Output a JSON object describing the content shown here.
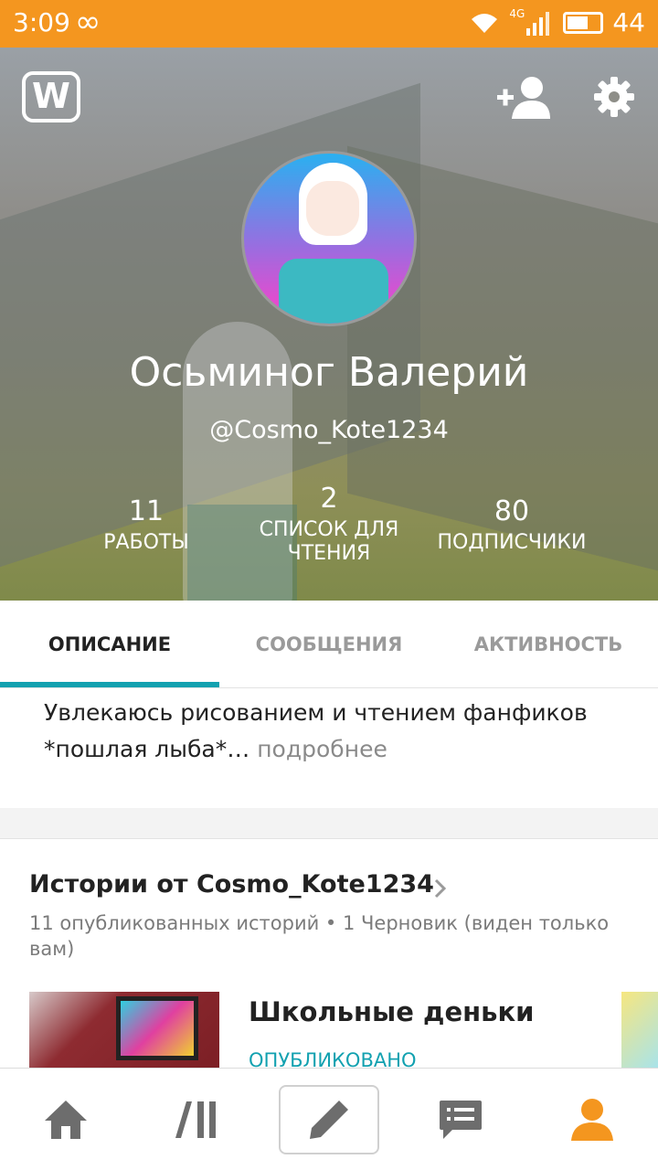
{
  "status_bar": {
    "time": "3:09",
    "infinity": "∞",
    "network": "4G",
    "battery": "44"
  },
  "header": {
    "logo": "W",
    "name": "Осьминог Валерий",
    "handle": "@Cosmo_Kote1234",
    "icons": [
      "wattpad-logo-icon",
      "add-friend-icon",
      "gear-icon"
    ]
  },
  "stats": {
    "works": {
      "value": "11",
      "label": "РАБОТЫ"
    },
    "reading_lists": {
      "value": "2",
      "label_line1": "СПИСОК ДЛЯ",
      "label_line2": "ЧТЕНИЯ"
    },
    "followers": {
      "value": "80",
      "label": "ПОДПИСЧИКИ"
    }
  },
  "tabs": [
    {
      "label": "ОПИСАНИЕ",
      "active": true
    },
    {
      "label": "СООБЩЕНИЯ",
      "active": false
    },
    {
      "label": "АКТИВНОСТЬ",
      "active": false
    }
  ],
  "about": {
    "text": "Увлекаюсь рисованием и чтением фанфиков *пошлая лыба*…",
    "more": " подробнее"
  },
  "stories": {
    "title": "Истории от Cosmo_Kote1234",
    "subtitle": "11 опубликованных историй • 1 Черновик (виден только вам)",
    "items": [
      {
        "title": "Школьные деньки",
        "status": "ОПУБЛИКОВАНО"
      }
    ]
  },
  "bottom_nav": {
    "items": [
      "home-icon",
      "library-icon",
      "write-icon",
      "messages-icon",
      "profile-icon"
    ],
    "accent": "#f4961f",
    "inactive": "#6d6d6d"
  },
  "colors": {
    "status_bar": "#f4961f",
    "tab_indicator": "#12a1b0"
  }
}
